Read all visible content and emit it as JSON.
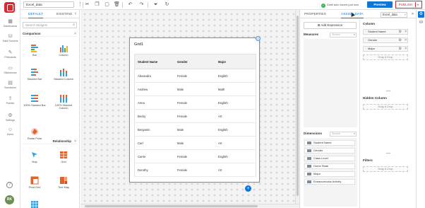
{
  "nav": {
    "items": [
      {
        "label": "Dashboards",
        "icon": "dashboard-icon"
      },
      {
        "label": "Data Sources",
        "icon": "datasource-icon"
      },
      {
        "label": "Pinboards",
        "icon": "pin-icon"
      },
      {
        "label": "Slideshows",
        "icon": "slideshow-icon"
      },
      {
        "label": "Schedules",
        "icon": "schedule-icon"
      },
      {
        "label": "Publish",
        "icon": "publish-icon"
      },
      {
        "label": "Settings",
        "icon": "gear-icon"
      },
      {
        "label": "Users",
        "icon": "users-icon"
      }
    ],
    "help": "?",
    "avatar_initials": "RK",
    "brand_color": "#e0242b"
  },
  "topbar": {
    "datasource_name": "Excel_data",
    "saved_status": "Draft auto saved just now",
    "preview_label": "Preview",
    "publish_label": "PUBLISH",
    "accent": "#0e76d3"
  },
  "widgets_panel": {
    "tabs": [
      "DEFAULT",
      "EXISTING"
    ],
    "search_placeholder": "Search Widgets",
    "groups": [
      {
        "label": "Comparison",
        "items": [
          "Bar",
          "Column",
          "Stacked Bar",
          "Stacked Column",
          "100% Stacked Bar",
          "100% Stacked Column",
          "Radar Polar"
        ]
      },
      {
        "label": "Relationship",
        "items": [
          "Map",
          "Grid",
          "Pivot Grid",
          "Tree Map"
        ]
      }
    ]
  },
  "canvas": {
    "widget_title": "Grid1",
    "grid": {
      "columns": [
        "Student Name",
        "Gender",
        "Major"
      ],
      "rows": [
        [
          "Alexandra",
          "Female",
          "English"
        ],
        [
          "Andrew",
          "Male",
          "Math"
        ],
        [
          "Anna",
          "Female",
          "English"
        ],
        [
          "Becky",
          "Female",
          "Art"
        ],
        [
          "Benjamin",
          "Male",
          "English"
        ],
        [
          "Carl",
          "Male",
          "Art"
        ],
        [
          "Carrie",
          "Female",
          "English"
        ],
        [
          "Dorothy",
          "Female",
          "Art"
        ]
      ]
    },
    "add_button": "+"
  },
  "properties_panel": {
    "tabs": [
      "PROPERTIES",
      "ASSIGN DATA"
    ],
    "datasource_select": "Excel_data",
    "add_expression": "Add Expression",
    "measures_label": "Measures",
    "measures_search": "Search",
    "dimensions_label": "Dimensions",
    "dimensions_search": "Search",
    "dimensions": [
      "Student Name",
      "Gender",
      "Class Level",
      "Home State",
      "Major",
      "Extracurricular Activity"
    ],
    "column_label": "Column",
    "column_fields": [
      "Student Name",
      "Gender",
      "Major"
    ],
    "drag_drop": "Drag & Drop",
    "hidden_column_label": "Hidden Column",
    "filters_label": "Filters"
  }
}
